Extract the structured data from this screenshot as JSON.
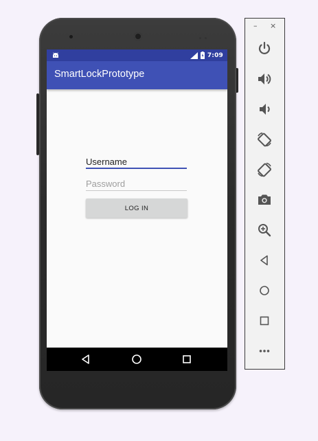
{
  "device": {
    "status_bar": {
      "time": "7:09"
    },
    "app_bar": {
      "title": "SmartLockPrototype"
    },
    "form": {
      "username": {
        "value": "Username"
      },
      "password": {
        "placeholder": "Password"
      },
      "login_button": {
        "label": "LOG IN"
      }
    },
    "nav_bar": {
      "icons": [
        "back-icon",
        "home-icon",
        "recents-icon"
      ]
    }
  },
  "emulator_toolbar": {
    "window_controls": {
      "minimize": "–",
      "close": "×"
    },
    "icons": [
      "power-icon",
      "volume-up-icon",
      "volume-down-icon",
      "rotate-left-icon",
      "rotate-right-icon",
      "camera-icon",
      "zoom-icon",
      "back-icon",
      "home-icon",
      "overview-icon",
      "more-icon"
    ]
  },
  "colors": {
    "primary": "#3f51b5",
    "primary_dark": "#303f9f",
    "toolbar_icon": "#555555"
  }
}
